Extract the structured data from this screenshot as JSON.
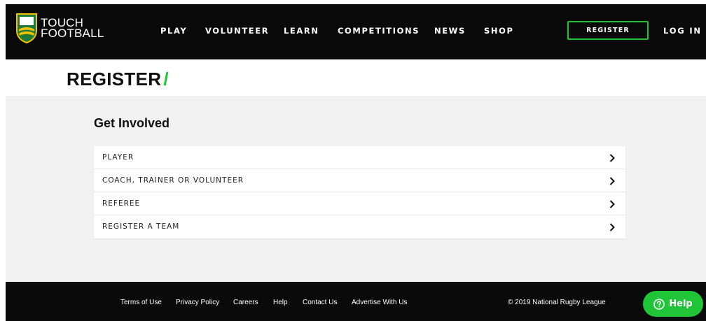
{
  "brand": {
    "logo_line1": "TOUCH",
    "logo_line2": "FOOTBALL",
    "logo_badge_text": "NRL TOUCH FOOTBALL",
    "accent_color": "#1fc437",
    "header_bg": "#0a0a0a"
  },
  "nav": {
    "items": [
      {
        "label": "PLAY"
      },
      {
        "label": "VOLUNTEER"
      },
      {
        "label": "LEARN"
      },
      {
        "label": "COMPETITIONS"
      },
      {
        "label": "NEWS"
      },
      {
        "label": "SHOP"
      }
    ],
    "register_label": "REGISTER",
    "login_label": "LOG IN"
  },
  "page": {
    "title": "REGISTER",
    "title_suffix": "/"
  },
  "section": {
    "heading": "Get Involved",
    "options": [
      {
        "label": "PLAYER",
        "icon": "chevron-right-icon"
      },
      {
        "label": "COACH, TRAINER OR VOLUNTEER",
        "icon": "chevron-right-icon"
      },
      {
        "label": "REFEREE",
        "icon": "chevron-right-icon"
      },
      {
        "label": "REGISTER A TEAM",
        "icon": "chevron-right-icon"
      }
    ]
  },
  "footer": {
    "links": [
      {
        "label": "Terms of Use"
      },
      {
        "label": "Privacy Policy"
      },
      {
        "label": "Careers"
      },
      {
        "label": "Help"
      },
      {
        "label": "Contact Us"
      },
      {
        "label": "Advertise With Us"
      }
    ],
    "copyright": "© 2019 National Rugby League"
  },
  "help_widget": {
    "label": "Help",
    "icon": "question-circle-icon"
  }
}
